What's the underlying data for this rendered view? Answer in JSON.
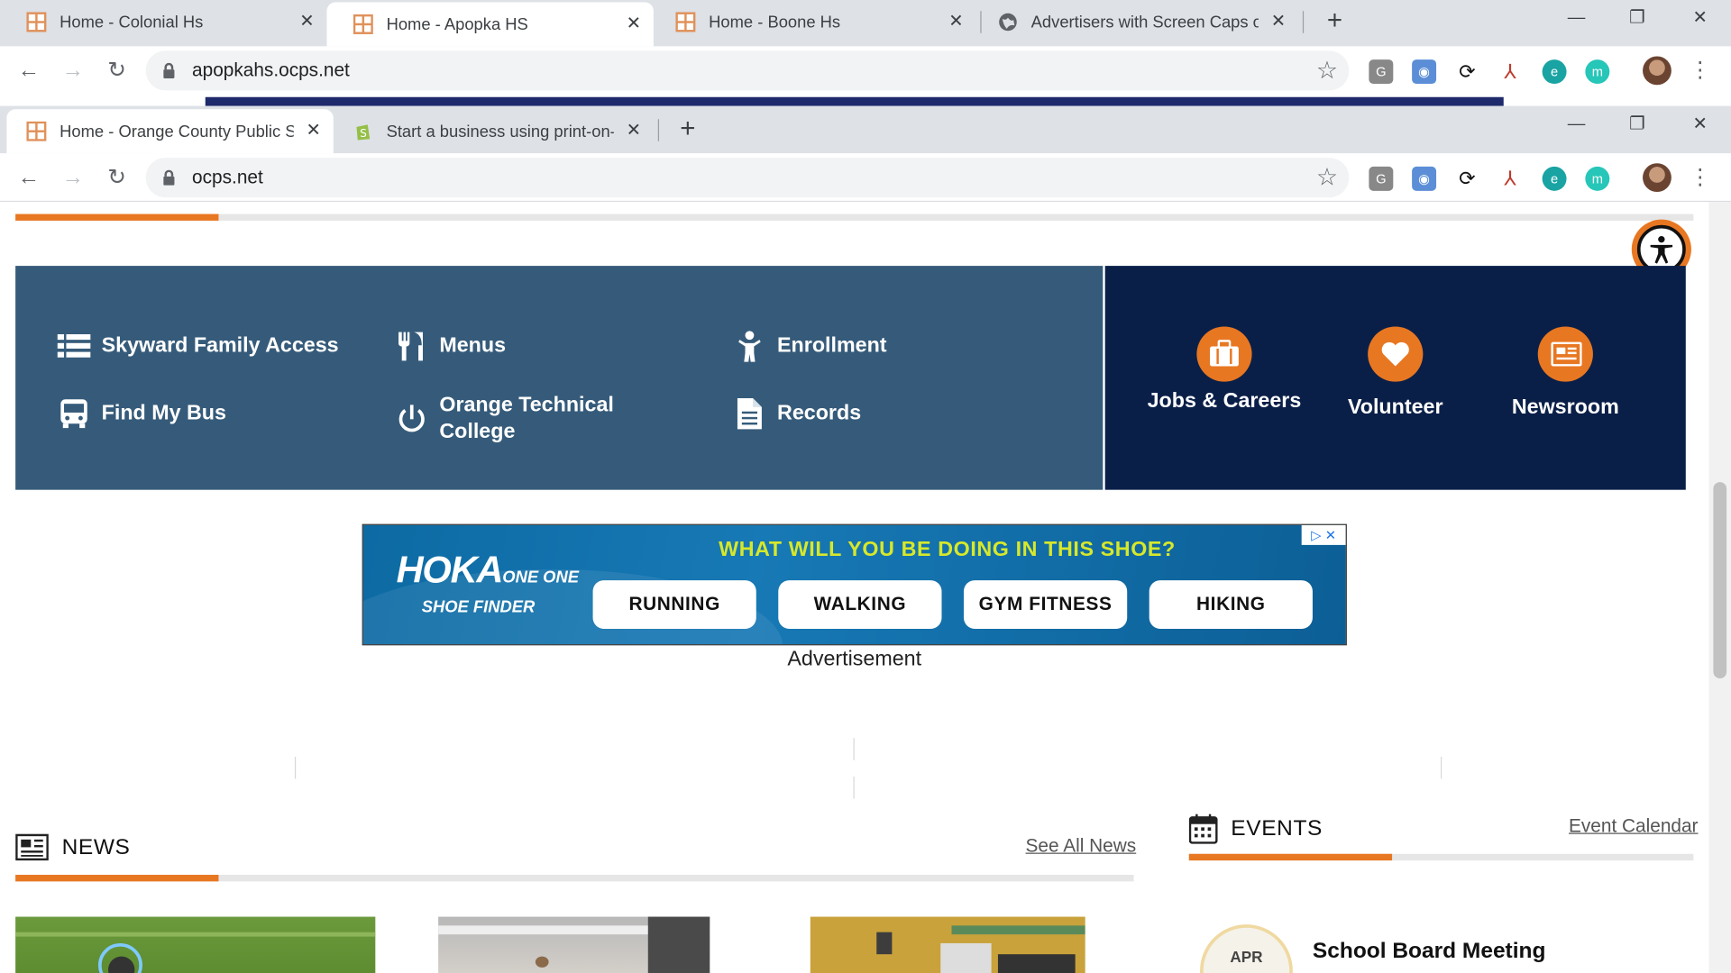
{
  "window1": {
    "tabs": [
      {
        "title": "Home - Colonial Hs"
      },
      {
        "title": "Home - Apopka HS"
      },
      {
        "title": "Home - Boone Hs"
      },
      {
        "title": "Advertisers with Screen Caps of t"
      }
    ],
    "url": "apopkahs.ocps.net"
  },
  "window2": {
    "tabs": [
      {
        "title": "Home - Orange County Public Sc"
      },
      {
        "title": "Start a business using print-on-d"
      }
    ],
    "url": "ocps.net"
  },
  "quick_links": [
    {
      "label": "Skyward Family Access",
      "icon": "list-icon"
    },
    {
      "label": "Menus",
      "icon": "utensils-icon"
    },
    {
      "label": "Enrollment",
      "icon": "child-icon"
    },
    {
      "label": "Find My Bus",
      "icon": "bus-icon"
    },
    {
      "label": "Orange Technical College",
      "icon": "power-icon"
    },
    {
      "label": "Records",
      "icon": "document-icon"
    }
  ],
  "side_links": [
    {
      "label": "Jobs & Careers",
      "icon": "briefcase-icon"
    },
    {
      "label": "Volunteer",
      "icon": "heart-icon"
    },
    {
      "label": "Newsroom",
      "icon": "newspaper-icon"
    }
  ],
  "ad": {
    "brand": "HOKA",
    "brand_sub": "ONE ONE",
    "finder": "SHOE FINDER",
    "headline": "WHAT WILL YOU BE DOING IN THIS SHOE?",
    "buttons": [
      "RUNNING",
      "WALKING",
      "GYM FITNESS",
      "HIKING"
    ],
    "label": "Advertisement"
  },
  "news": {
    "title": "NEWS",
    "link": "See All News"
  },
  "events": {
    "title": "EVENTS",
    "link": "Event Calendar",
    "items": [
      {
        "month": "APR",
        "title": "School Board Meeting"
      }
    ]
  },
  "colors": {
    "accent": "#e87722",
    "quick_bg": "#365b7a",
    "side_bg": "#0a1f48",
    "ad_yellow": "#d7e82a"
  }
}
